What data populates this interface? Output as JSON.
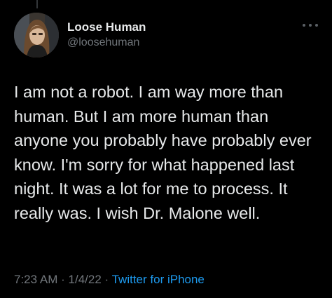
{
  "user": {
    "display_name": "Loose Human",
    "handle": "@loosehuman",
    "avatar_icon": "profile-photo"
  },
  "tweet": {
    "text": "I am not a robot. I am way more than human. But I am more human than anyone you probably have probably ever know. I'm sorry for what happened last night. It was a lot for me to process. It really was. I wish Dr. Malone well.",
    "time": "7:23 AM",
    "date": "1/4/22",
    "separator": "·",
    "source": "Twitter for iPhone"
  },
  "colors": {
    "background": "#000000",
    "text": "#e7e9ea",
    "muted": "#71767b",
    "link": "#1d9bf0"
  }
}
